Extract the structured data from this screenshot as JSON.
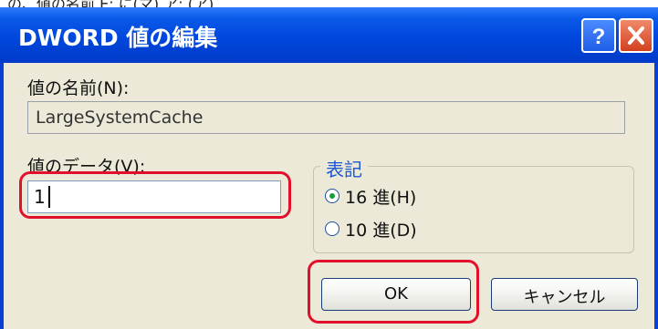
{
  "window": {
    "title": "DWORD 値の編集",
    "help_glyph": "?",
    "close_glyph": "X"
  },
  "top_strip_text": "の、値の名前 E: に(マ) ア: (ア)",
  "value_name": {
    "label": "値の名前(N):",
    "value": "LargeSystemCache"
  },
  "value_data": {
    "label": "値のデータ(V):",
    "value": "1"
  },
  "base": {
    "legend": "表記",
    "options": [
      {
        "label": "16 進(H)",
        "selected": true
      },
      {
        "label": "10 進(D)",
        "selected": false
      }
    ]
  },
  "buttons": {
    "ok": "OK",
    "cancel": "キャンセル"
  },
  "colors": {
    "highlight": "#e2102b",
    "titlebar": "#0047dd",
    "client_bg": "#ece9d8"
  }
}
